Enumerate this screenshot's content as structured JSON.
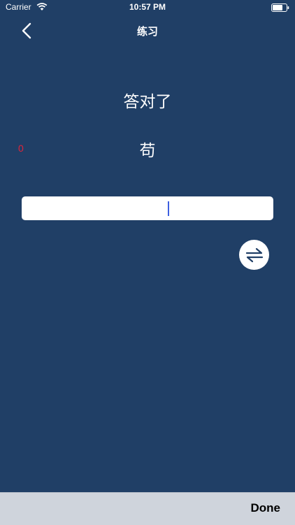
{
  "status_bar": {
    "carrier": "Carrier",
    "time": "10:57 PM"
  },
  "nav": {
    "title": "练习",
    "back_icon": "chevron-left-icon"
  },
  "practice": {
    "result": "答对了",
    "counter": "0",
    "character": "苟",
    "answer_value": "",
    "answer_placeholder": ""
  },
  "swap": {
    "icon": "swap-arrows-icon"
  },
  "keyboard_toolbar": {
    "done_label": "Done"
  },
  "colors": {
    "background": "#203f66",
    "counter": "#e0243a",
    "caret": "#3d5fe0",
    "toolbar": "#cfd4dc"
  }
}
